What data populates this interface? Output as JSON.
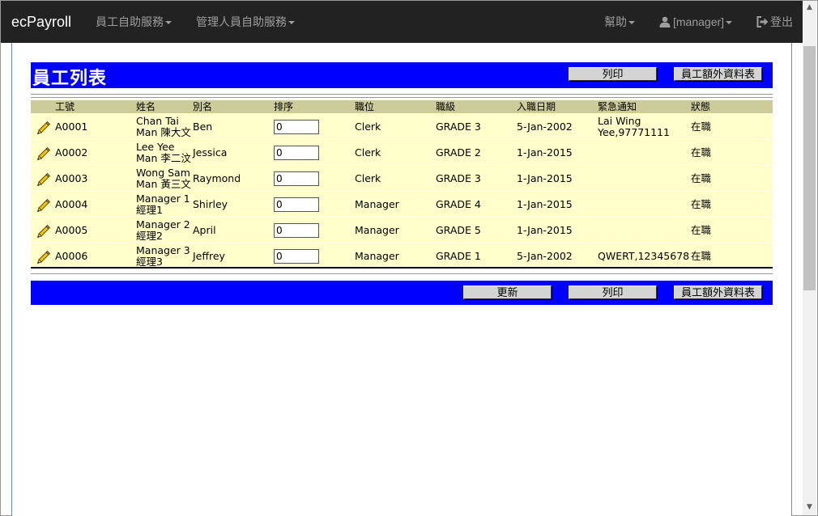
{
  "navbar": {
    "brand": "ecPayroll",
    "employee_menu": "員工自助服務",
    "manager_menu": "管理人員自助服務",
    "help": "幫助",
    "user": "[manager]",
    "logout": "登出"
  },
  "page": {
    "title": "員工列表",
    "print_button": "列印",
    "extra_info_button": "員工額外資料表",
    "update_button": "更新"
  },
  "table": {
    "headers": [
      "工號",
      "姓名",
      "別名",
      "排序",
      "職位",
      "職級",
      "入職日期",
      "緊急通知",
      "狀態"
    ],
    "rows": [
      {
        "id": "A0001",
        "name_line1": "Chan Tai",
        "name_line2": "Man 陳大文",
        "alias": "Ben",
        "order": "0",
        "position": "Clerk",
        "grade": "GRADE 3",
        "join_date": "5-Jan-2002",
        "emergency_line1": "Lai Wing",
        "emergency_line2": "Yee,97771111",
        "status": "在職"
      },
      {
        "id": "A0002",
        "name_line1": "Lee Yee",
        "name_line2": "Man 李二汶",
        "alias": "Jessica",
        "order": "0",
        "position": "Clerk",
        "grade": "GRADE 2",
        "join_date": "1-Jan-2015",
        "emergency_line1": "",
        "emergency_line2": "",
        "status": "在職"
      },
      {
        "id": "A0003",
        "name_line1": "Wong Sam",
        "name_line2": "Man 黃三文",
        "alias": "Raymond",
        "order": "0",
        "position": "Clerk",
        "grade": "GRADE 3",
        "join_date": "1-Jan-2015",
        "emergency_line1": "",
        "emergency_line2": "",
        "status": "在職"
      },
      {
        "id": "A0004",
        "name_line1": "Manager 1",
        "name_line2": "經理1",
        "alias": "Shirley",
        "order": "0",
        "position": "Manager",
        "grade": "GRADE 4",
        "join_date": "1-Jan-2015",
        "emergency_line1": "",
        "emergency_line2": "",
        "status": "在職"
      },
      {
        "id": "A0005",
        "name_line1": "Manager 2",
        "name_line2": "經理2",
        "alias": "April",
        "order": "0",
        "position": "Manager",
        "grade": "GRADE 5",
        "join_date": "1-Jan-2015",
        "emergency_line1": "",
        "emergency_line2": "",
        "status": "在職"
      },
      {
        "id": "A0006",
        "name_line1": "Manager 3",
        "name_line2": "經理3",
        "alias": "Jeffrey",
        "order": "0",
        "position": "Manager",
        "grade": "GRADE 1",
        "join_date": "5-Jan-2002",
        "emergency_line1": "QWERT,12345678",
        "emergency_line2": "",
        "status": "在職"
      }
    ]
  },
  "icons": {
    "edit": "pencil-icon",
    "user": "user-icon",
    "logout": "logout-icon",
    "dropdown": "caret-down-icon"
  },
  "colors": {
    "navbar_bg": "#222222",
    "bar_blue": "#0000ff",
    "table_header_bg": "#cccc99",
    "table_row_bg": "#ffffcc",
    "button_bg": "#d4d4d4"
  }
}
